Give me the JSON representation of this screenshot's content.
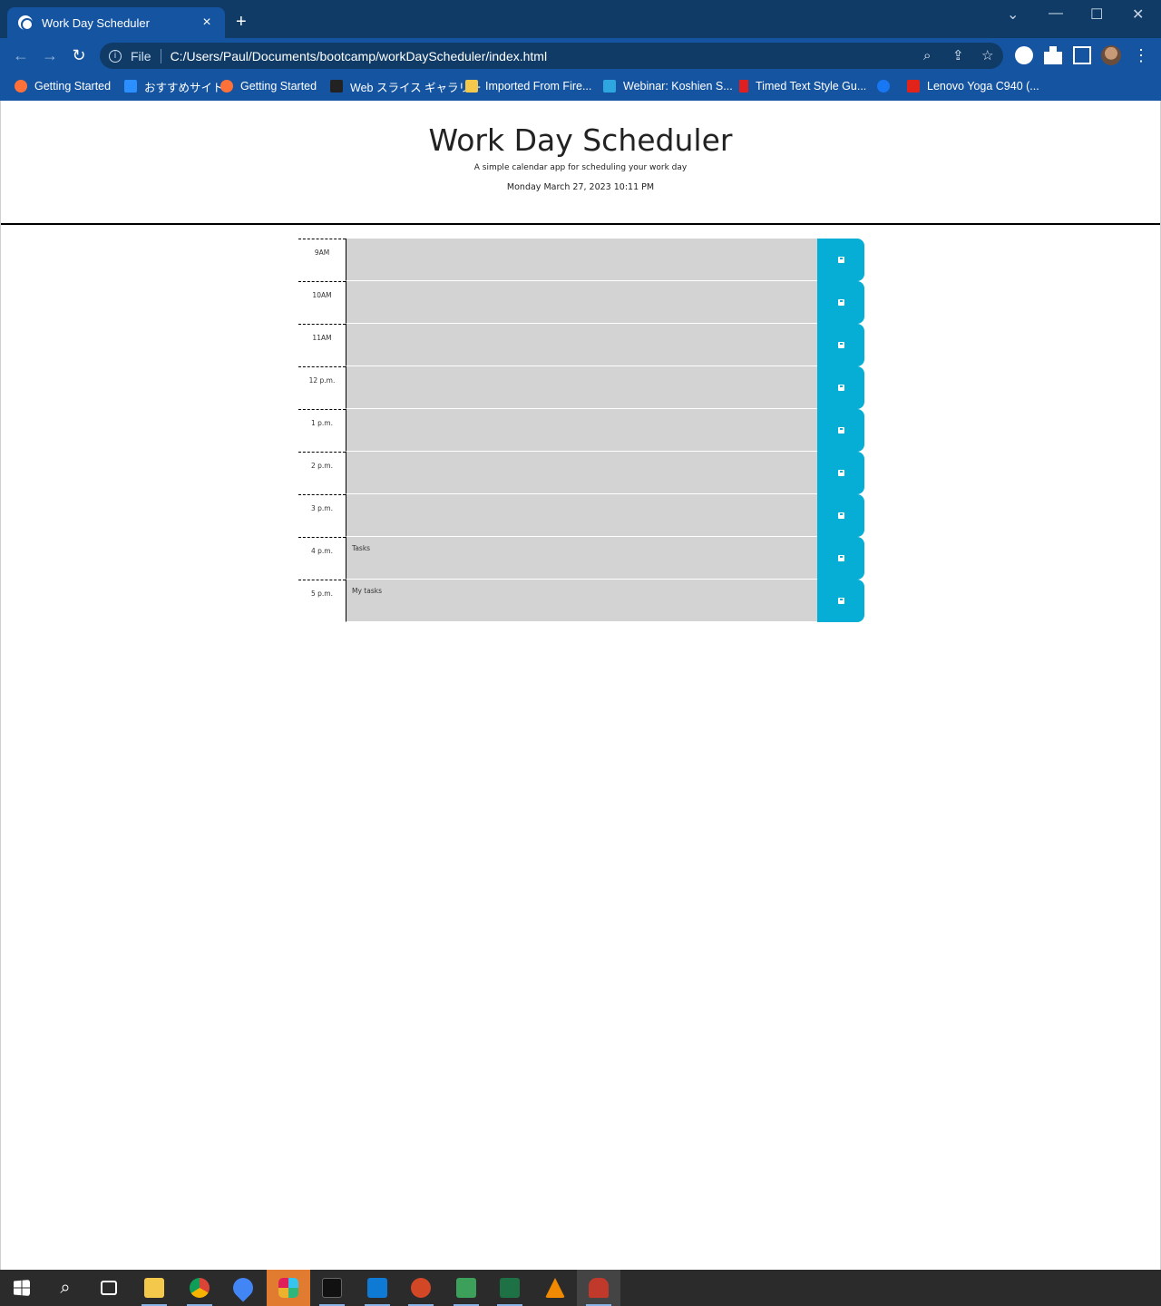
{
  "browser": {
    "tab_title": "Work Day Scheduler",
    "tab_close": "×",
    "new_tab": "+",
    "window_controls": [
      "⌄",
      "—",
      "☐",
      "✕"
    ],
    "nav": {
      "back": "←",
      "forward": "→",
      "reload": "↻"
    },
    "address": {
      "scheme_label": "File",
      "url": "C:/Users/Paul/Documents/bootcamp/workDayScheduler/index.html"
    },
    "omnibox_icons": [
      "zoom-icon",
      "share-icon",
      "star-icon"
    ],
    "menu": "⋮"
  },
  "bookmarks": [
    {
      "label": "Getting Started",
      "icon": "firefox-icon",
      "color": "#ff7139"
    },
    {
      "label": "おすすめサイト",
      "icon": "bing-icon",
      "color": "#2b8fff"
    },
    {
      "label": "Getting Started",
      "icon": "firefox-icon",
      "color": "#ff7139"
    },
    {
      "label": "Web スライス ギャラリー",
      "icon": "slice-icon",
      "color": "#222222"
    },
    {
      "label": "Imported From Fire...",
      "icon": "folder-icon",
      "color": "#f4c84a"
    },
    {
      "label": "Webinar: Koshien S...",
      "icon": "webinar-icon",
      "color": "#2ea7e0"
    },
    {
      "label": "Timed Text Style Gu...",
      "icon": "bookmark-icon",
      "color": "#e02020"
    },
    {
      "label": "",
      "icon": "facebook-icon",
      "color": "#1877f2"
    },
    {
      "label": "Lenovo Yoga C940 (...",
      "icon": "lenovo-icon",
      "color": "#e2231a"
    }
  ],
  "header": {
    "title": "Work Day Scheduler",
    "lead": "A simple calendar app for scheduling your work day",
    "current_day": "Monday March 27, 2023 10:11 PM"
  },
  "schedule": [
    {
      "hour": "9AM",
      "text": ""
    },
    {
      "hour": "10AM",
      "text": ""
    },
    {
      "hour": "11AM",
      "text": ""
    },
    {
      "hour": "12 p.m.",
      "text": ""
    },
    {
      "hour": "1 p.m.",
      "text": ""
    },
    {
      "hour": "2 p.m.",
      "text": ""
    },
    {
      "hour": "3 p.m.",
      "text": ""
    },
    {
      "hour": "4 p.m.",
      "text": "Tasks"
    },
    {
      "hour": "5 p.m.",
      "text": "My tasks"
    }
  ],
  "colors": {
    "save": "#06aed5",
    "past": "#d3d3d3",
    "chrome": "#1554a0",
    "tabbar": "#0f3b66"
  },
  "taskbar": [
    {
      "name": "start-icon",
      "color": "#ffffff"
    },
    {
      "name": "search-icon",
      "color": "#ffffff"
    },
    {
      "name": "task-view-icon",
      "color": "#ffffff"
    },
    {
      "name": "file-explorer-icon",
      "color": "#f4c84a"
    },
    {
      "name": "chrome-icon",
      "color": "#4caf50"
    },
    {
      "name": "maps-icon",
      "color": "#4285f4"
    },
    {
      "name": "slack-icon",
      "color": "#e01e5a"
    },
    {
      "name": "terminal-icon",
      "color": "#111111"
    },
    {
      "name": "vscode-icon",
      "color": "#0e7ad3"
    },
    {
      "name": "powerpoint-icon",
      "color": "#d24726"
    },
    {
      "name": "remote-desktop-icon",
      "color": "#3c9f5a"
    },
    {
      "name": "excel-icon",
      "color": "#1e7145"
    },
    {
      "name": "vlc-icon",
      "color": "#f18a00"
    },
    {
      "name": "snipping-tool-icon",
      "color": "#c0392b"
    }
  ]
}
